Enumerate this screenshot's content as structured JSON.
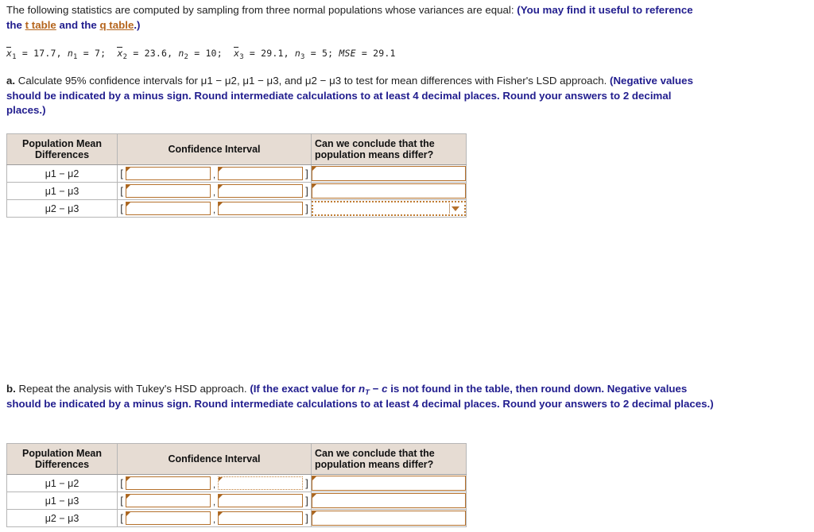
{
  "intro": {
    "text_plain_1": "The following statistics are computed by sampling from three normal populations whose variances are equal: ",
    "bold_1": "(You may find it useful to reference the ",
    "link_t": "t table",
    "bold_2": " and the ",
    "link_q": "q table",
    "bold_3": ".)"
  },
  "stats": {
    "x1_label": "x",
    "x1_sub": "1",
    "x1_value": "17.7",
    "n1_label": "n",
    "n1_sub": "1",
    "n1_value": "7",
    "x2_label": "x",
    "x2_sub": "2",
    "x2_value": "23.6",
    "n2_label": "n",
    "n2_sub": "2",
    "n2_value": "10",
    "x3_label": "x",
    "x3_sub": "3",
    "x3_value": "29.1",
    "n3_label": "n",
    "n3_sub": "3",
    "n3_value": "5",
    "mse_label": "MSE",
    "mse_value": "29.1",
    "eq": "=",
    "comma": ",",
    "semicolon": ";"
  },
  "part_a": {
    "letter": "a.",
    "text_1": " Calculate 95% confidence intervals for ",
    "pair_1": "μ1 − μ2",
    "sep_1": ", ",
    "pair_2": "μ1 − μ3",
    "sep_2": ", and ",
    "pair_3": "μ2 − μ3",
    "text_2": " to test for mean differences with Fisher's LSD approach.",
    "note": "(Negative values should be indicated by a minus sign. Round intermediate calculations to at least 4 decimal places. Round your answers to 2 decimal places.)"
  },
  "part_b": {
    "letter": "b.",
    "text_1": " Repeat the analysis with Tukey's HSD approach. ",
    "note_1": "(If the exact value for ",
    "note_var": "n",
    "note_var_sub": "T",
    "note_minus": " − ",
    "note_c": "c",
    "note_2": " is not found in the table, then round down. Negative values should be indicated by a minus sign. Round intermediate calculations to at least 4 decimal places. Round your answers to 2 decimal places.)"
  },
  "table_headers": {
    "col_differences": "Population Mean\nDifferences",
    "col_differences_line1": "Population Mean",
    "col_differences_line2": "Differences",
    "col_interval": "Confidence Interval",
    "col_conclude_line1": "Can we conclude that the",
    "col_conclude_line2": "population means differ?"
  },
  "table_a": {
    "rows": [
      {
        "label": "μ1 − μ2",
        "lower": "",
        "upper": "",
        "conclusion": "",
        "lower_focused": false,
        "upper_focused": false,
        "conclusion_is_dropdown": false
      },
      {
        "label": "μ1 − μ3",
        "lower": "",
        "upper": "",
        "conclusion": "",
        "lower_focused": false,
        "upper_focused": false,
        "conclusion_is_dropdown": false
      },
      {
        "label": "μ2 − μ3",
        "lower": "",
        "upper": "",
        "conclusion": "",
        "lower_focused": false,
        "upper_focused": false,
        "conclusion_is_dropdown": true
      }
    ]
  },
  "table_b": {
    "rows": [
      {
        "label": "μ1 − μ2",
        "lower": "",
        "upper": "",
        "conclusion": "",
        "lower_focused": false,
        "upper_focused": true,
        "conclusion_is_dropdown": false
      },
      {
        "label": "μ1 − μ3",
        "lower": "",
        "upper": "",
        "conclusion": "",
        "lower_focused": false,
        "upper_focused": false,
        "conclusion_is_dropdown": false
      },
      {
        "label": "μ2 − μ3",
        "lower": "",
        "upper": "",
        "conclusion": "",
        "lower_focused": false,
        "upper_focused": false,
        "conclusion_is_dropdown": false
      }
    ]
  },
  "symbols": {
    "bracket_open": "[",
    "bracket_close": "]",
    "comma": ","
  },
  "colors": {
    "accent_blue": "#211d8e",
    "link_orange": "#b5651d",
    "input_border": "#b5712c",
    "header_bg": "#e6dcd3"
  }
}
